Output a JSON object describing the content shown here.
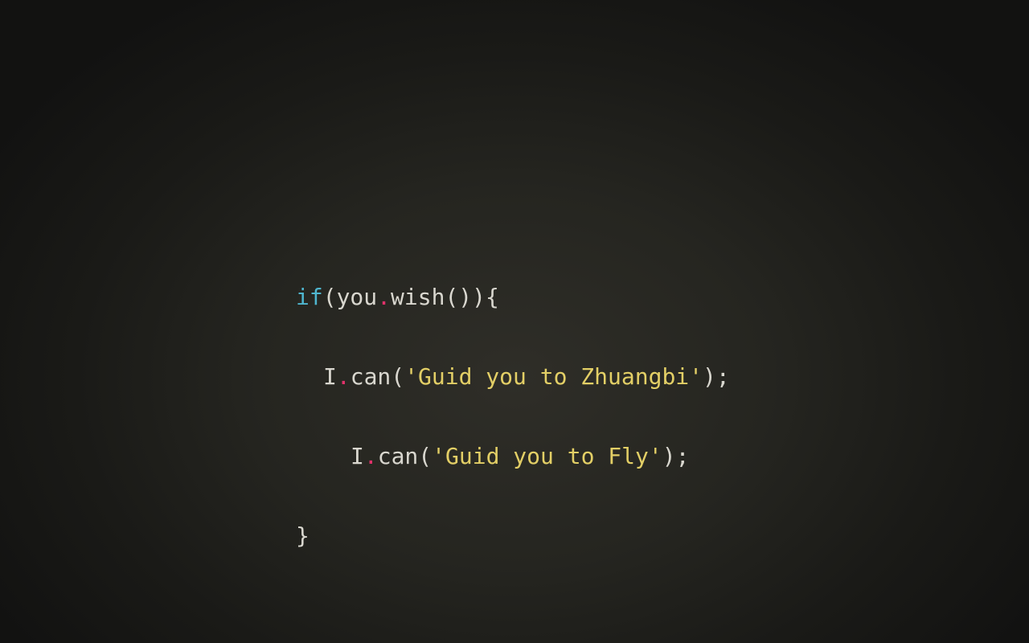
{
  "colors": {
    "background_center": "#2f2e28",
    "background_edge": "#121211",
    "keyword": "#4fb6cf",
    "identifier": "#d9d7cf",
    "dot": "#e0316a",
    "string": "#e3cf66"
  },
  "code": {
    "line1": {
      "keyword": "if",
      "open_paren": "(",
      "object": "you",
      "dot": ".",
      "method": "wish",
      "call": "()",
      "close": "){"
    },
    "line2": {
      "object": "I",
      "dot": ".",
      "method": "can",
      "open": "(",
      "string": "'Guid you to Zhuangbi'",
      "close": ");"
    },
    "line3": {
      "object": "I",
      "dot": ".",
      "method": "can",
      "open": "(",
      "string": "'Guid you to Fly'",
      "close": ");"
    },
    "line4": {
      "close_brace": "}"
    }
  }
}
